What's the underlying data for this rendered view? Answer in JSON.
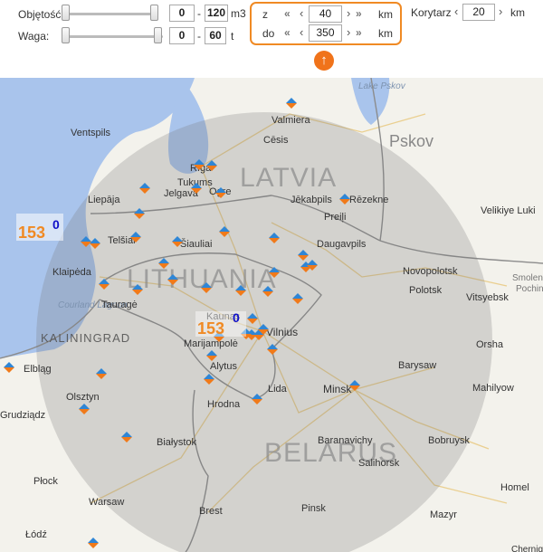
{
  "filters": {
    "volume": {
      "label": "Objętość",
      "min": "0",
      "sep": "-",
      "max": "120",
      "unit": "m3"
    },
    "weight": {
      "label": "Waga:",
      "min": "0",
      "sep": "-",
      "max": "60",
      "unit": "t"
    },
    "distance": {
      "from_label": "z",
      "from_value": "40",
      "from_unit": "km",
      "to_label": "do",
      "to_value": "350",
      "to_unit": "km"
    },
    "corridor": {
      "label": "Korytarz",
      "value": "20",
      "unit": "km"
    },
    "collapse_icon": "arrow-up-icon"
  },
  "map": {
    "countries": [
      "LATVIA",
      "LITHUANIA",
      "BELARUS"
    ],
    "cities": [
      "Valmiera",
      "Ventspils",
      "Cēsis",
      "Pskov",
      "Rīga",
      "Tukums",
      "Jelgava",
      "Ogre",
      "Liepāja",
      "Jēkabpils",
      "Rēzekne",
      "Preiļi",
      "Velikiye Luki",
      "Telšiai",
      "Šiauliai",
      "Daugavpils",
      "Klaipėda",
      "Novopolotsk",
      "Polotsk",
      "Vitsyebsk",
      "Smolensk",
      "Pochinok",
      "Tauragė",
      "Kaunas",
      "Vilnius",
      "Marijampolė",
      "Orsha",
      "Alytus",
      "Elbląg",
      "Barysaw",
      "Olsztyn",
      "Minsk",
      "Mahilyow",
      "Hrodna",
      "Lida",
      "Grudziądz",
      "Białystok",
      "Baranavichy",
      "Bobruysk",
      "Salihorsk",
      "Płock",
      "Warsaw",
      "Homel",
      "Brest",
      "Pinsk",
      "Mazyr",
      "Łódź",
      "Chernigov"
    ],
    "water_labels": [
      "Lake Pskov",
      "Courland Lagoon"
    ],
    "region_label": "KALININGRAD",
    "cluster_kaliningrad": {
      "primary": "153",
      "secondary": "0"
    },
    "cluster_kaunas": {
      "primary": "153",
      "secondary": "0"
    },
    "marker_icon": "diamond-pin-icon"
  }
}
